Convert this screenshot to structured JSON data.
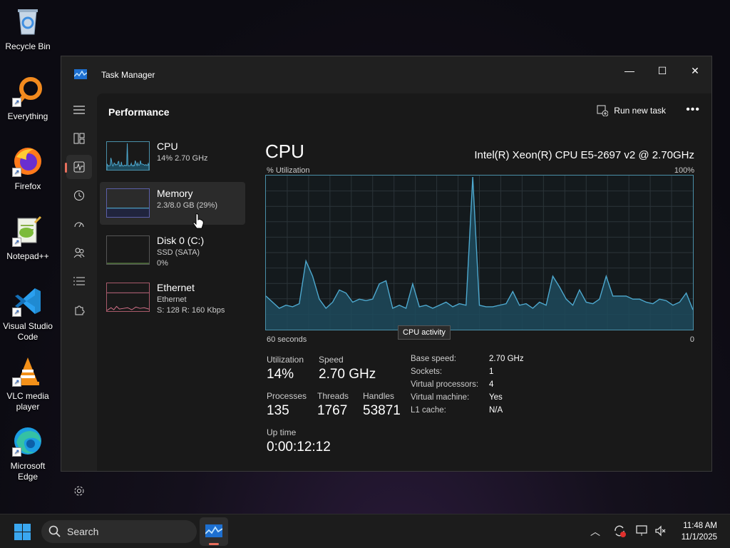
{
  "desktop": {
    "icons": [
      {
        "label": "Recycle Bin"
      },
      {
        "label": "Everything"
      },
      {
        "label": "Firefox"
      },
      {
        "label": "Notepad++"
      },
      {
        "label": "Visual Studio Code"
      },
      {
        "label": "VLC media player"
      },
      {
        "label": "Microsoft Edge"
      }
    ]
  },
  "window": {
    "title": "Task Manager",
    "controls": {
      "minimize": "—",
      "maximize": "☐",
      "close": "✕"
    }
  },
  "header": {
    "page_title": "Performance",
    "run_new_task": "Run new task",
    "more": "•••"
  },
  "side": {
    "cpu": {
      "name": "CPU",
      "sub": "14%  2.70 GHz"
    },
    "memory": {
      "name": "Memory",
      "sub": "2.3/8.0 GB (29%)"
    },
    "disk": {
      "name": "Disk 0 (C:)",
      "sub1": "SSD (SATA)",
      "sub2": "0%"
    },
    "ethernet": {
      "name": "Ethernet",
      "sub1": "Ethernet",
      "sub2": "S: 128  R: 160 Kbps"
    }
  },
  "main": {
    "heading": "CPU",
    "model": "Intel(R) Xeon(R) CPU E5-2697 v2 @ 2.70GHz",
    "graph_label_tl": "% Utilization",
    "graph_label_tr": "100%",
    "graph_label_bl": "60 seconds",
    "graph_label_br": "0",
    "tooltip": "CPU activity",
    "stats": {
      "utilization_lbl": "Utilization",
      "utilization": "14%",
      "speed_lbl": "Speed",
      "speed": "2.70 GHz",
      "processes_lbl": "Processes",
      "processes": "135",
      "threads_lbl": "Threads",
      "threads": "1767",
      "handles_lbl": "Handles",
      "handles": "53871",
      "uptime_lbl": "Up time",
      "uptime": "0:00:12:12"
    },
    "details": [
      {
        "k": "Base speed:",
        "v": "2.70 GHz"
      },
      {
        "k": "Sockets:",
        "v": "1"
      },
      {
        "k": "Virtual processors:",
        "v": "4"
      },
      {
        "k": "Virtual machine:",
        "v": "Yes"
      },
      {
        "k": "L1 cache:",
        "v": "N/A"
      }
    ]
  },
  "chart_data": {
    "type": "area",
    "title": "CPU",
    "ylim": [
      0,
      100
    ],
    "values": [
      22,
      18,
      14,
      16,
      15,
      17,
      45,
      35,
      20,
      14,
      18,
      26,
      24,
      18,
      20,
      19,
      20,
      30,
      32,
      14,
      16,
      14,
      30,
      15,
      16,
      14,
      16,
      18,
      15,
      17,
      16,
      100,
      16,
      15,
      15,
      16,
      17,
      25,
      16,
      17,
      14,
      18,
      16,
      35,
      28,
      20,
      16,
      26,
      18,
      17,
      20,
      35,
      22,
      22,
      22,
      20,
      20,
      18,
      17,
      20,
      19,
      16,
      18,
      24,
      13
    ]
  },
  "taskbar": {
    "search_placeholder": "Search",
    "time": "11:48 AM",
    "date": "11/1/2025"
  },
  "colors": {
    "accent": "#e86f5d",
    "graph_line": "#4ea9cf",
    "graph_fill": "#1d4a5c"
  }
}
